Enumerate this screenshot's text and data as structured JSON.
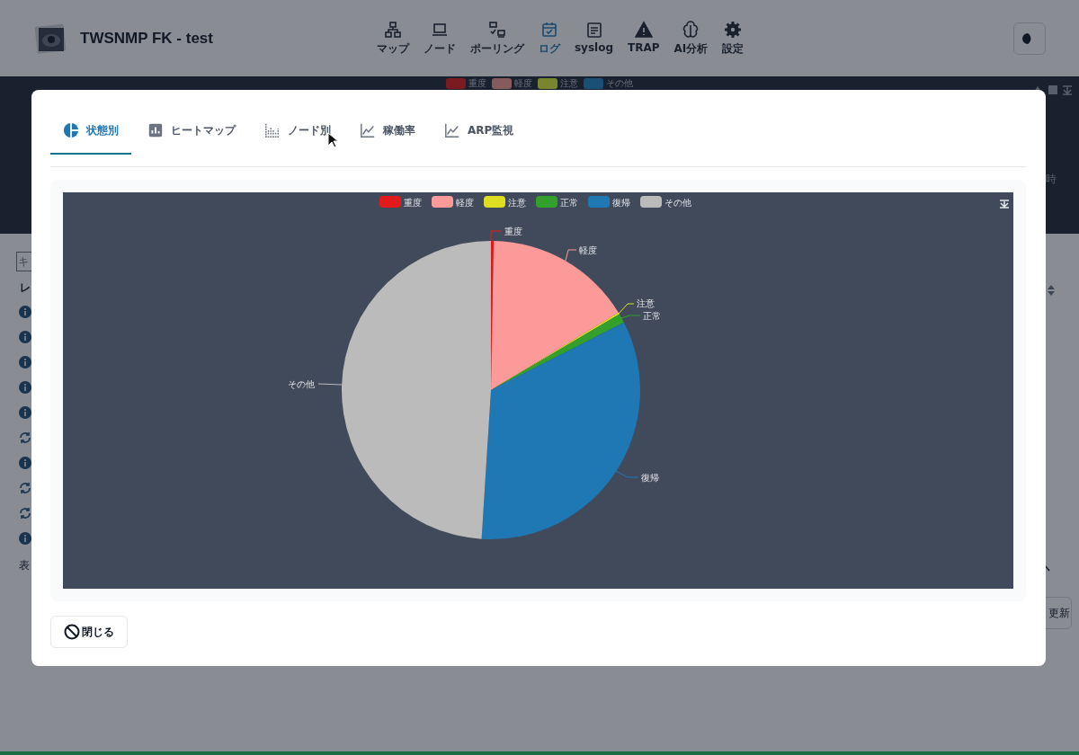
{
  "header": {
    "title": "TWSNMP FK - test",
    "nav": [
      {
        "label": "マップ",
        "selected": false
      },
      {
        "label": "ノード",
        "selected": false
      },
      {
        "label": "ポーリング",
        "selected": false
      },
      {
        "label": "ログ",
        "selected": true
      },
      {
        "label": "syslog",
        "selected": false
      },
      {
        "label": "TRAP",
        "selected": false
      },
      {
        "label": "AI分析",
        "selected": false
      },
      {
        "label": "設定",
        "selected": false
      }
    ]
  },
  "background": {
    "legend": [
      {
        "label": "重度",
        "color": "#7c1a21"
      },
      {
        "label": "軽度",
        "color": "#875a5e"
      },
      {
        "label": "注意",
        "color": "#7a8530"
      },
      {
        "label": "その他",
        "color": "#1a4f76"
      }
    ],
    "side_label": "時",
    "search": {
      "placeholder": "キ"
    },
    "column_header": "レ",
    "rows": [
      {
        "kind": "info"
      },
      {
        "kind": "info"
      },
      {
        "kind": "info"
      },
      {
        "kind": "info"
      },
      {
        "kind": "info"
      },
      {
        "kind": "repeat"
      },
      {
        "kind": "info"
      },
      {
        "kind": "repeat"
      },
      {
        "kind": "repeat"
      },
      {
        "kind": "info"
      }
    ],
    "footer_text": "表",
    "refresh_button": "更新"
  },
  "dialog": {
    "tabs": [
      {
        "label": "状態別",
        "selected": true
      },
      {
        "label": "ヒートマップ",
        "selected": false
      },
      {
        "label": "ノード別",
        "selected": false
      },
      {
        "label": "稼働率",
        "selected": false
      },
      {
        "label": "ARP監視",
        "selected": false
      }
    ],
    "chart": {
      "legend": [
        {
          "label": "重度",
          "color": "#e31a1c"
        },
        {
          "label": "軽度",
          "color": "#fb9a99"
        },
        {
          "label": "注意",
          "color": "#dfdf22"
        },
        {
          "label": "正常",
          "color": "#33a02c"
        },
        {
          "label": "復帰",
          "color": "#1f78b4"
        },
        {
          "label": "その他",
          "color": "#bbbbbb"
        }
      ],
      "slice_labels": [
        "重度",
        "軽度",
        "注意",
        "正常",
        "復帰",
        "その他"
      ]
    },
    "close_button": "閉じる"
  }
}
